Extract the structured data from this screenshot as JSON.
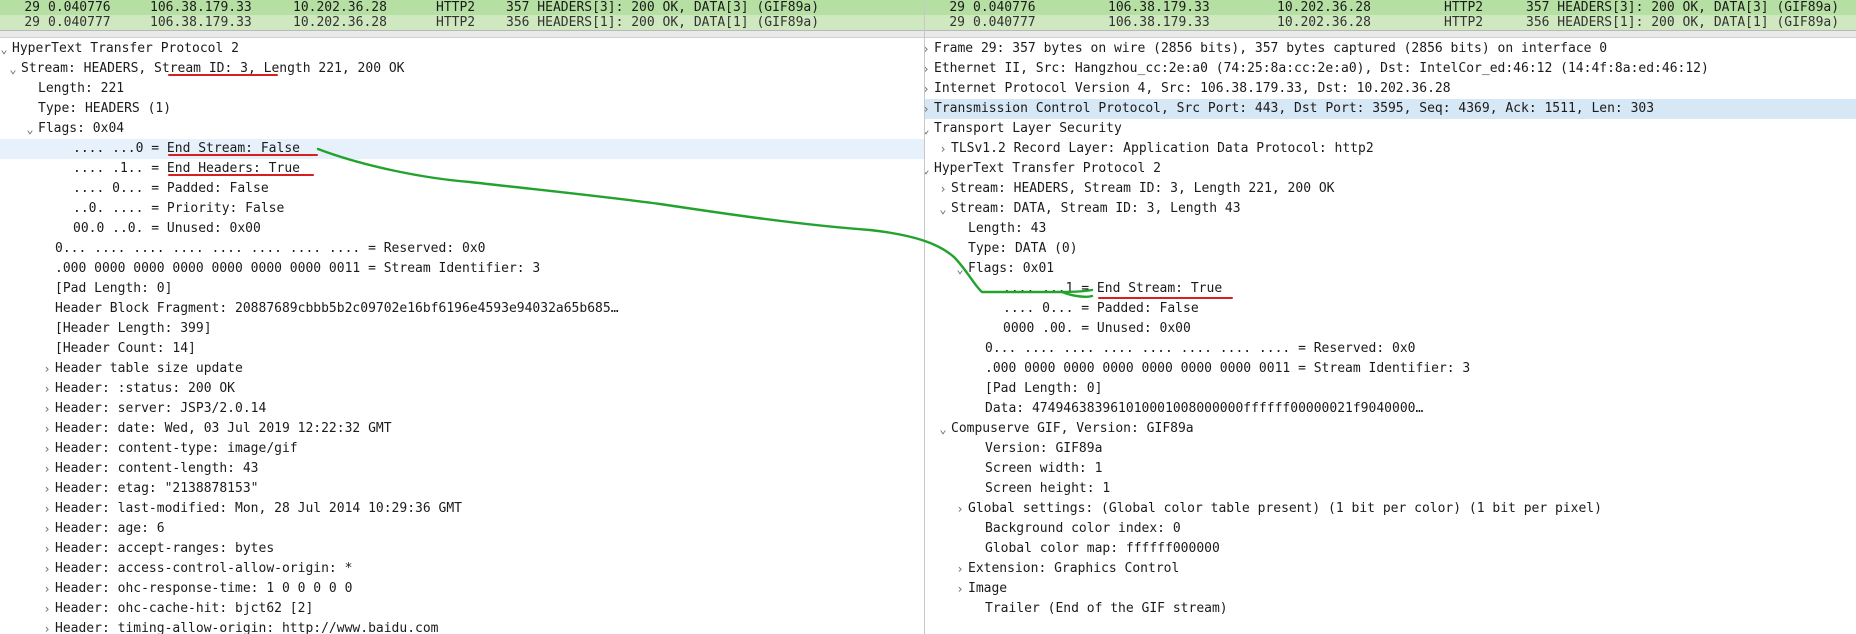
{
  "packet_list": {
    "selected": {
      "no": "29",
      "time": "0.040776",
      "src": "106.38.179.33",
      "dst": "10.202.36.28",
      "proto": "HTTP2",
      "info": "357 HEADERS[3]: 200 OK, DATA[3] (GIF89a)"
    },
    "next": {
      "no": "29",
      "time": "0.040777",
      "src": "106.38.179.33",
      "dst": "10.202.36.28",
      "proto": "HTTP2",
      "info": "356 HEADERS[1]: 200 OK, DATA[1] (GIF89a)"
    }
  },
  "left_tree": [
    {
      "indent": 0,
      "toggle": "expanded",
      "text": "HyperText Transfer Protocol 2"
    },
    {
      "indent": 1,
      "toggle": "expanded",
      "text": "Stream: HEADERS, Stream ID: 3, Length 221, 200 OK"
    },
    {
      "indent": 2,
      "toggle": "none",
      "text": "Length: 221"
    },
    {
      "indent": 2,
      "toggle": "none",
      "text": "Type: HEADERS (1)"
    },
    {
      "indent": 2,
      "toggle": "expanded",
      "text": "Flags: 0x04"
    },
    {
      "indent": 4,
      "toggle": "none",
      "text": ".... ...0 = End Stream: False",
      "highlight": true
    },
    {
      "indent": 4,
      "toggle": "none",
      "text": ".... .1.. = End Headers: True"
    },
    {
      "indent": 4,
      "toggle": "none",
      "text": ".... 0... = Padded: False"
    },
    {
      "indent": 4,
      "toggle": "none",
      "text": "..0. .... = Priority: False"
    },
    {
      "indent": 4,
      "toggle": "none",
      "text": "00.0 ..0. = Unused: 0x00"
    },
    {
      "indent": 3,
      "toggle": "none",
      "text": "0... .... .... .... .... .... .... .... = Reserved: 0x0"
    },
    {
      "indent": 3,
      "toggle": "none",
      "text": ".000 0000 0000 0000 0000 0000 0000 0011 = Stream Identifier: 3"
    },
    {
      "indent": 3,
      "toggle": "none",
      "text": "[Pad Length: 0]"
    },
    {
      "indent": 3,
      "toggle": "none",
      "text": "Header Block Fragment: 20887689cbbb5b2c09702e16bf6196e4593e94032a65b685…"
    },
    {
      "indent": 3,
      "toggle": "none",
      "text": "[Header Length: 399]"
    },
    {
      "indent": 3,
      "toggle": "none",
      "text": "[Header Count: 14]"
    },
    {
      "indent": 3,
      "toggle": "collapsed",
      "text": "Header table size update"
    },
    {
      "indent": 3,
      "toggle": "collapsed",
      "text": "Header: :status: 200 OK"
    },
    {
      "indent": 3,
      "toggle": "collapsed",
      "text": "Header: server: JSP3/2.0.14"
    },
    {
      "indent": 3,
      "toggle": "collapsed",
      "text": "Header: date: Wed, 03 Jul 2019 12:22:32 GMT"
    },
    {
      "indent": 3,
      "toggle": "collapsed",
      "text": "Header: content-type: image/gif"
    },
    {
      "indent": 3,
      "toggle": "collapsed",
      "text": "Header: content-length: 43"
    },
    {
      "indent": 3,
      "toggle": "collapsed",
      "text": "Header: etag: \"2138878153\""
    },
    {
      "indent": 3,
      "toggle": "collapsed",
      "text": "Header: last-modified: Mon, 28 Jul 2014 10:29:36 GMT"
    },
    {
      "indent": 3,
      "toggle": "collapsed",
      "text": "Header: age: 6"
    },
    {
      "indent": 3,
      "toggle": "collapsed",
      "text": "Header: accept-ranges: bytes"
    },
    {
      "indent": 3,
      "toggle": "collapsed",
      "text": "Header: access-control-allow-origin: *"
    },
    {
      "indent": 3,
      "toggle": "collapsed",
      "text": "Header: ohc-response-time: 1 0 0 0 0 0"
    },
    {
      "indent": 3,
      "toggle": "collapsed",
      "text": "Header: ohc-cache-hit: bjct62 [2]"
    },
    {
      "indent": 3,
      "toggle": "collapsed",
      "text": "Header: timing-allow-origin: http://www.baidu.com"
    }
  ],
  "right_tree": [
    {
      "indent": 0,
      "toggle": "collapsed",
      "text": "Frame 29: 357 bytes on wire (2856 bits), 357 bytes captured (2856 bits) on interface 0"
    },
    {
      "indent": 0,
      "toggle": "collapsed",
      "text": "Ethernet II, Src: Hangzhou_cc:2e:a0 (74:25:8a:cc:2e:a0), Dst: IntelCor_ed:46:12 (14:4f:8a:ed:46:12)"
    },
    {
      "indent": 0,
      "toggle": "collapsed",
      "text": "Internet Protocol Version 4, Src: 106.38.179.33, Dst: 10.202.36.28"
    },
    {
      "indent": 0,
      "toggle": "collapsed",
      "text": "Transmission Control Protocol, Src Port: 443, Dst Port: 3595, Seq: 4369, Ack: 1511, Len: 303",
      "highlight2": true
    },
    {
      "indent": 0,
      "toggle": "expanded",
      "text": "Transport Layer Security"
    },
    {
      "indent": 1,
      "toggle": "collapsed",
      "text": "TLSv1.2 Record Layer: Application Data Protocol: http2"
    },
    {
      "indent": 0,
      "toggle": "expanded",
      "text": "HyperText Transfer Protocol 2"
    },
    {
      "indent": 1,
      "toggle": "collapsed",
      "text": "Stream: HEADERS, Stream ID: 3, Length 221, 200 OK"
    },
    {
      "indent": 1,
      "toggle": "expanded",
      "text": "Stream: DATA, Stream ID: 3, Length 43"
    },
    {
      "indent": 2,
      "toggle": "none",
      "text": "Length: 43"
    },
    {
      "indent": 2,
      "toggle": "none",
      "text": "Type: DATA (0)"
    },
    {
      "indent": 2,
      "toggle": "expanded",
      "text": "Flags: 0x01"
    },
    {
      "indent": 4,
      "toggle": "none",
      "text": ".... ...1 = End Stream: True"
    },
    {
      "indent": 4,
      "toggle": "none",
      "text": ".... 0... = Padded: False"
    },
    {
      "indent": 4,
      "toggle": "none",
      "text": "0000 .00. = Unused: 0x00"
    },
    {
      "indent": 3,
      "toggle": "none",
      "text": "0... .... .... .... .... .... .... .... = Reserved: 0x0"
    },
    {
      "indent": 3,
      "toggle": "none",
      "text": ".000 0000 0000 0000 0000 0000 0000 0011 = Stream Identifier: 3"
    },
    {
      "indent": 3,
      "toggle": "none",
      "text": "[Pad Length: 0]"
    },
    {
      "indent": 3,
      "toggle": "none",
      "text": "Data: 474946383961010001008000000ffffff00000021f9040000…"
    },
    {
      "indent": 1,
      "toggle": "expanded",
      "text": "Compuserve GIF, Version: GIF89a"
    },
    {
      "indent": 3,
      "toggle": "none",
      "text": "Version: GIF89a"
    },
    {
      "indent": 3,
      "toggle": "none",
      "text": "Screen width: 1"
    },
    {
      "indent": 3,
      "toggle": "none",
      "text": "Screen height: 1"
    },
    {
      "indent": 2,
      "toggle": "collapsed",
      "text": "Global settings: (Global color table present) (1 bit per color) (1 bit per pixel)"
    },
    {
      "indent": 3,
      "toggle": "none",
      "text": "Background color index: 0"
    },
    {
      "indent": 3,
      "toggle": "none",
      "text": "Global color map: ffffff000000"
    },
    {
      "indent": 2,
      "toggle": "collapsed",
      "text": "Extension: Graphics Control"
    },
    {
      "indent": 2,
      "toggle": "collapsed",
      "text": "Image"
    },
    {
      "indent": 3,
      "toggle": "none",
      "text": "Trailer (End of the GIF stream)"
    }
  ],
  "colors": {
    "packet_row_bg": "#cfe8bf",
    "packet_row_selected_bg": "#b6dfa3",
    "selected_field_bg": "#e6f1fb",
    "selected_protocol_bg": "#d6e7f6",
    "underline_red": "#d81e1e",
    "connector_green": "#22a32e"
  },
  "icons": {
    "expanded": "chevron-down-icon",
    "collapsed": "chevron-right-icon"
  }
}
